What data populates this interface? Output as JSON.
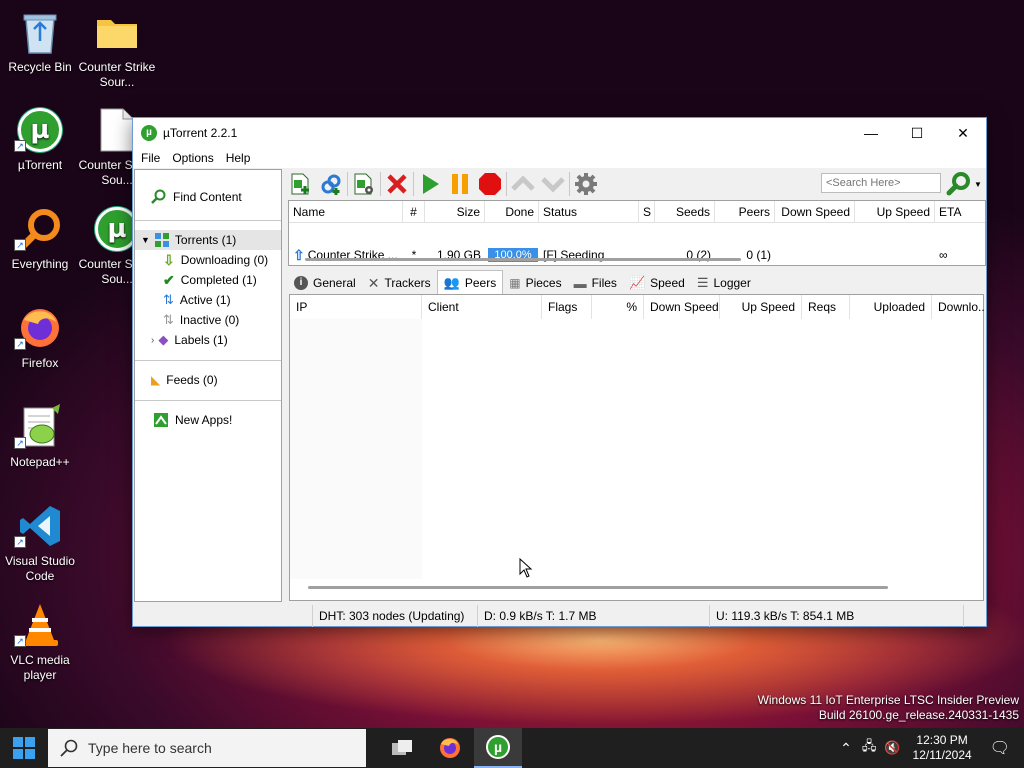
{
  "desktop": {
    "icons": [
      {
        "label": "Recycle Bin"
      },
      {
        "label": "Counter Strike Sour..."
      },
      {
        "label": "µTorrent"
      },
      {
        "label": "Counter Strike Sou..."
      },
      {
        "label": "Everything"
      },
      {
        "label": "Counter Strike Sou..."
      },
      {
        "label": "Firefox"
      },
      {
        "label": "Notepad++"
      },
      {
        "label": "Visual Studio Code"
      },
      {
        "label": "VLC media player"
      }
    ],
    "watermark_line1": "Windows 11 IoT Enterprise LTSC Insider Preview",
    "watermark_line2": "Build 26100.ge_release.240331-1435"
  },
  "window": {
    "title": "µTorrent 2.2.1",
    "controls": {
      "minimize": "—",
      "maximize": "☐",
      "close": "✕"
    }
  },
  "menu": [
    "File",
    "Options",
    "Help"
  ],
  "sidebar": {
    "find_content": "Find Content",
    "torrents": "Torrents (1)",
    "downloading": "Downloading (0)",
    "completed": "Completed (1)",
    "active": "Active (1)",
    "inactive": "Inactive (0)",
    "labels": "Labels (1)",
    "feeds": "Feeds (0)",
    "new_apps": "New Apps!"
  },
  "toolbar": {
    "search_placeholder": "<Search Here>"
  },
  "torrent_list": {
    "columns": [
      "Name",
      "#",
      "Size",
      "Done",
      "Status",
      "S",
      "Seeds",
      "Peers",
      "Down Speed",
      "Up Speed",
      "ETA"
    ],
    "rows": [
      {
        "name": "Counter Strike ...",
        "num": "*",
        "size": "1.90 GB",
        "done": "100.0%",
        "done_fraction": 1.0,
        "status": "[F] Seeding",
        "seeds": "0 (2)",
        "peers": "0 (1)",
        "down_speed": "",
        "up_speed": "",
        "eta": "∞"
      }
    ]
  },
  "detail_tabs": [
    "General",
    "Trackers",
    "Peers",
    "Pieces",
    "Files",
    "Speed",
    "Logger"
  ],
  "peers_table": {
    "columns": [
      "IP",
      "Client",
      "Flags",
      "%",
      "Down Speed",
      "Up Speed",
      "Reqs",
      "Uploaded",
      "Downlo..."
    ]
  },
  "statusbar": {
    "dht": "DHT: 303 nodes (Updating)",
    "down": "D: 0.9 kB/s T: 1.7 MB",
    "up": "U: 119.3 kB/s T: 854.1 MB"
  },
  "taskbar": {
    "search_placeholder": "Type here to search",
    "time": "12:30 PM",
    "date": "12/11/2024"
  },
  "colors": {
    "accent": "#3399ff",
    "progress": "#3a8fe6",
    "utorrent_green": "#2fa02f"
  }
}
